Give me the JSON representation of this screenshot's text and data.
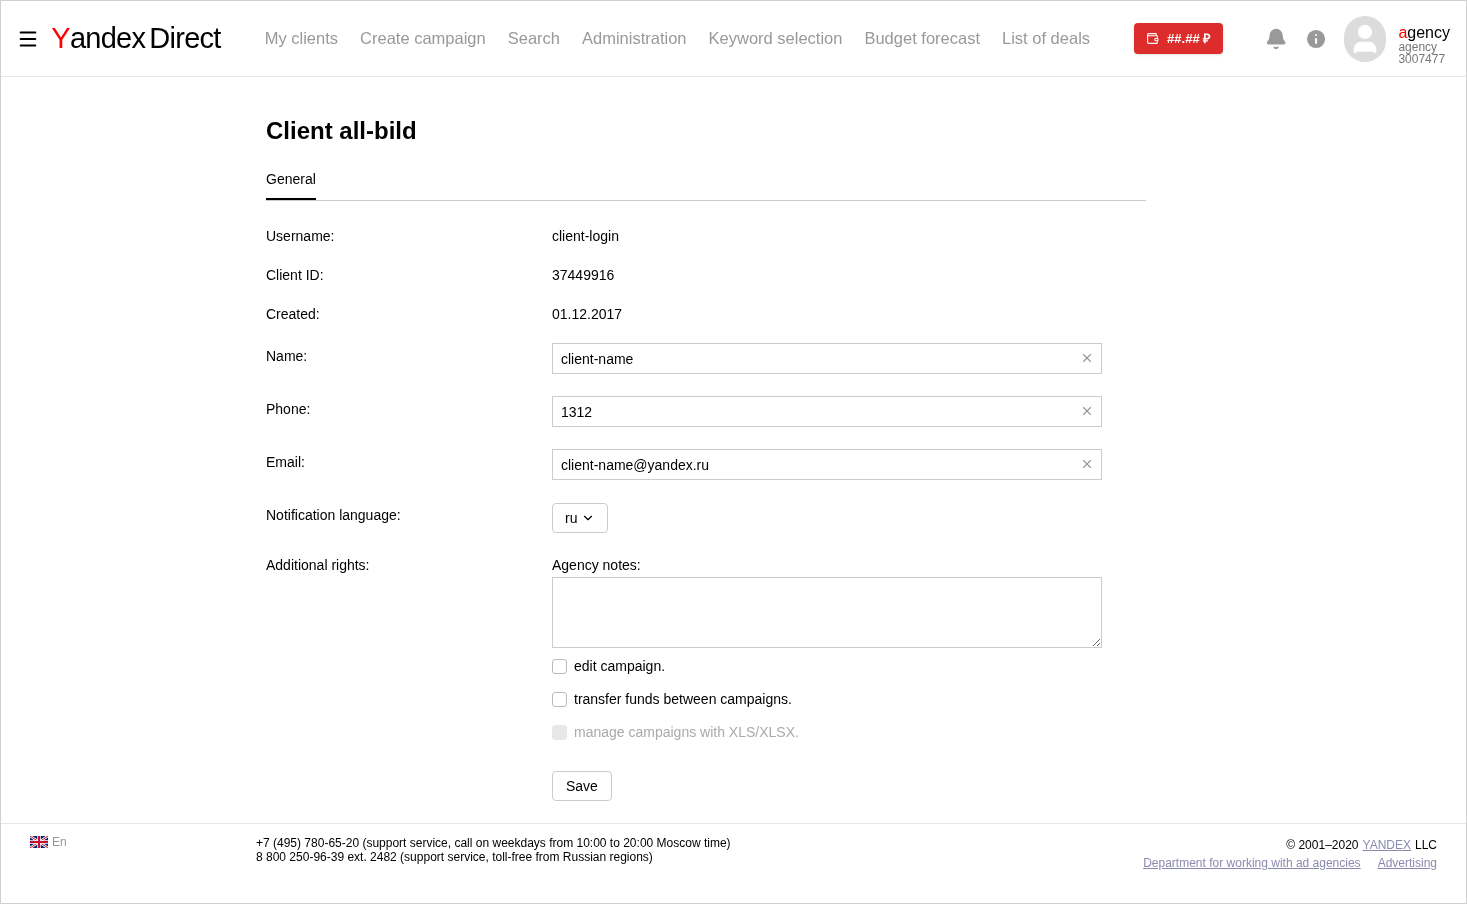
{
  "header": {
    "logo": {
      "brand_initial": "Y",
      "brand_rest": "andex",
      "product": "Direct"
    },
    "nav": [
      {
        "label": "My clients",
        "selected": false
      },
      {
        "label": "Create campaign",
        "selected": false
      },
      {
        "label": "Search",
        "selected": false
      },
      {
        "label": "Administration",
        "selected": false
      },
      {
        "label": "Keyword selection",
        "selected": false
      },
      {
        "label": "Budget forecast",
        "selected": false
      },
      {
        "label": "List of deals",
        "selected": false
      }
    ],
    "balance": "##.## ₽",
    "user": {
      "name_initial": "a",
      "name_rest": "gency",
      "role": "agency",
      "id": "3007477"
    }
  },
  "page": {
    "title": "Client all-bild",
    "tabs": [
      {
        "label": "General",
        "selected": true
      }
    ],
    "fields": [
      {
        "kind": "text",
        "label": "Username:",
        "value": "client-login"
      },
      {
        "kind": "text",
        "label": "Client ID:",
        "value": "37449916"
      },
      {
        "kind": "text",
        "label": "Created:",
        "value": "01.12.2017"
      },
      {
        "kind": "input",
        "label": "Name:",
        "value": "client-name"
      },
      {
        "kind": "input",
        "label": "Phone:",
        "value": "1312"
      },
      {
        "kind": "input",
        "label": "Email:",
        "value": "client-name@yandex.ru"
      },
      {
        "kind": "select",
        "label": "Notification language:",
        "value": "ru"
      }
    ],
    "rights": {
      "label": "Additional rights:",
      "notes_label": "Agency notes:",
      "options": [
        {
          "label": "edit campaign.",
          "checked": false,
          "disabled": false
        },
        {
          "label": "transfer funds between campaigns.",
          "checked": false,
          "disabled": false
        },
        {
          "label": "manage campaigns with XLS/XLSX.",
          "checked": false,
          "disabled": true
        }
      ]
    },
    "save": "Save"
  },
  "footer": {
    "language": "En",
    "phones": [
      "+7 (495) 780-65-20 (support service, call on weekdays from 10:00 to 20:00 Moscow time)",
      "8 800 250-96-39 ext. 2482 (support service, toll-free from Russian regions)"
    ],
    "copyright": "© 2001–2020",
    "company_link": "YANDEX",
    "company_suffix": "LLC",
    "links": [
      "Department for working with ad agencies",
      "Advertising"
    ]
  }
}
